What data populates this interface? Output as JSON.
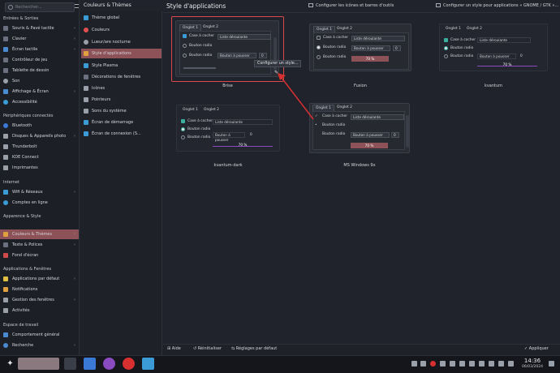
{
  "search": {
    "placeholder": "Rechercher..."
  },
  "sidebar": {
    "sections": [
      {
        "label": "Entrées & Sorties"
      },
      {
        "label": "Périphériques connectés"
      },
      {
        "label": "Internet"
      },
      {
        "label": "Apparence & Style"
      },
      {
        "label": "Applications & Fenêtres"
      },
      {
        "label": "Espace de travail"
      }
    ],
    "items": [
      {
        "label": "Souris & Pavé tactile",
        "chev": "›"
      },
      {
        "label": "Clavier",
        "chev": "›"
      },
      {
        "label": "Écran tactile",
        "chev": "›"
      },
      {
        "label": "Contrôleur de jeu",
        "chev": ""
      },
      {
        "label": "Tablette de dessin",
        "chev": ""
      },
      {
        "label": "Son",
        "chev": ""
      },
      {
        "label": "Affichage & Écran",
        "chev": "›"
      },
      {
        "label": "Accessibilité",
        "chev": ""
      },
      {
        "label": "Bluetooth",
        "chev": ""
      },
      {
        "label": "Disques & Appareils photo",
        "chev": "›"
      },
      {
        "label": "Thunderbolt",
        "chev": ""
      },
      {
        "label": "KDE Connect",
        "chev": ""
      },
      {
        "label": "Imprimantes",
        "chev": ""
      },
      {
        "label": "Wifi & Réseaux",
        "chev": "›"
      },
      {
        "label": "Comptes en ligne",
        "chev": ""
      },
      {
        "label": "Couleurs & Thèmes",
        "chev": "›"
      },
      {
        "label": "Texte & Polices",
        "chev": "›"
      },
      {
        "label": "Fond d'écran",
        "chev": ""
      },
      {
        "label": "Applications par défaut",
        "chev": "›"
      },
      {
        "label": "Notifications",
        "chev": ""
      },
      {
        "label": "Gestion des fenêtres",
        "chev": "›"
      },
      {
        "label": "Activités",
        "chev": ""
      },
      {
        "label": "Comportement général",
        "chev": ""
      },
      {
        "label": "Recherche",
        "chev": "›"
      }
    ]
  },
  "middle": {
    "title": "Couleurs & Thèmes",
    "items": [
      {
        "label": "Thème global"
      },
      {
        "label": "Couleurs"
      },
      {
        "label": "Lueur/are nocturne"
      },
      {
        "label": "Style d'applications"
      },
      {
        "label": "Style Plasma"
      },
      {
        "label": "Décorations de fenêtres"
      },
      {
        "label": "Icônes"
      },
      {
        "label": "Pointeurs"
      },
      {
        "label": "Sons du système"
      },
      {
        "label": "Écran de démarrage"
      },
      {
        "label": "Écran de connexion (S..."
      }
    ]
  },
  "header": {
    "title": "Style d'applications",
    "btn1": "Configurer les icônes et barres d'outils",
    "btn2": "Configurer un style pour applications « GNOME / GTK »..."
  },
  "preview": {
    "tab1": "Onglet 1",
    "tab2": "Onglet 2",
    "checkbox": "Case à cocher",
    "radio": "Bouton radio",
    "dropdown": "Liste déroulante",
    "pushbutton": "Bouton à pousser",
    "spin": "0",
    "progress": "70 %",
    "tooltip": "Configurer un style..."
  },
  "styles": [
    {
      "name": "Brise"
    },
    {
      "name": "Fusion"
    },
    {
      "name": "kvantum"
    },
    {
      "name": "kvantum-dark"
    },
    {
      "name": "MS Windows 9x"
    }
  ],
  "bottom": {
    "help": "Aide",
    "reset": "Réinitialiser",
    "defaults": "Réglages par défaut",
    "apply": "Appliquer"
  },
  "taskbar": {
    "time": "14:36",
    "date": "06/03/2024"
  },
  "colors": {
    "accent": "#8d5158",
    "highlight": "#d84a4a",
    "check": "#3a9bd6"
  }
}
